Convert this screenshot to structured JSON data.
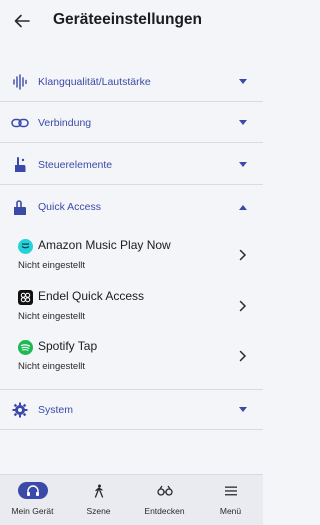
{
  "header": {
    "title": "Geräteeinstellungen"
  },
  "sections": {
    "sound": {
      "label": "Klangqualität/Lautstärke"
    },
    "connection": {
      "label": "Verbindung"
    },
    "controls": {
      "label": "Steuerelemente"
    },
    "quick_access": {
      "label": "Quick Access"
    },
    "system": {
      "label": "System"
    }
  },
  "quick_access_items": [
    {
      "title": "Amazon Music Play Now",
      "status": "Nicht eingestellt"
    },
    {
      "title": "Endel Quick Access",
      "status": "Nicht eingestellt"
    },
    {
      "title": "Spotify Tap",
      "status": "Nicht eingestellt"
    }
  ],
  "bottom_nav": [
    {
      "label": "Mein Gerät"
    },
    {
      "label": "Szene"
    },
    {
      "label": "Entdecken"
    },
    {
      "label": "Menü"
    }
  ],
  "colors": {
    "accent": "#3b4aa8",
    "background": "#f4f5f8",
    "nav_background": "#e9ebf0",
    "amazon": "#25d1da",
    "endel": "#111111",
    "spotify": "#1db954"
  }
}
